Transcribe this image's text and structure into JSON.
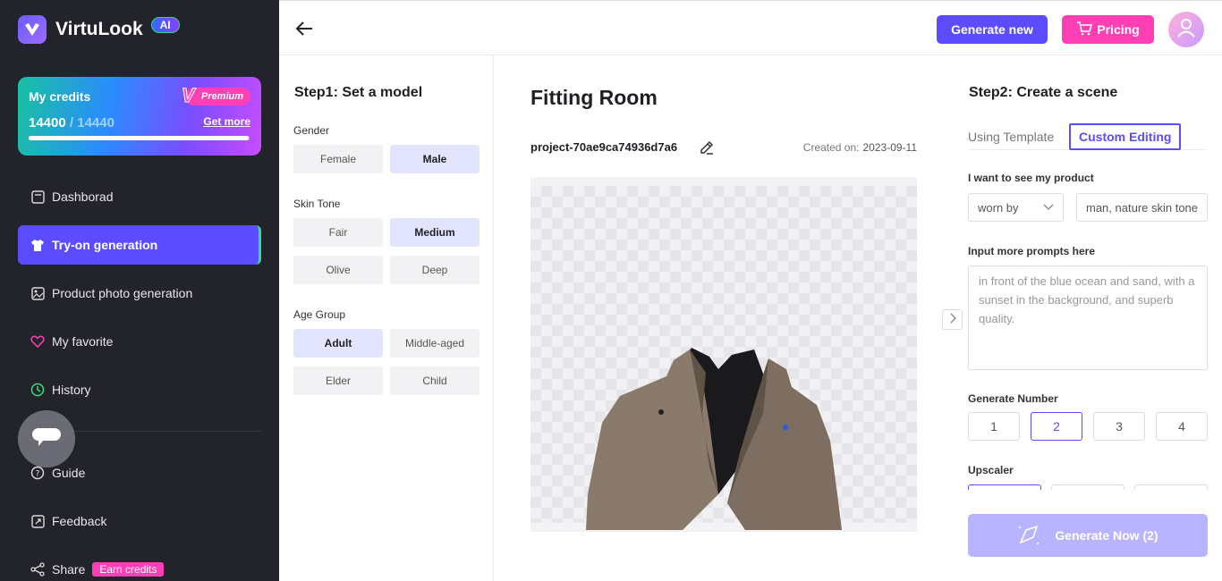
{
  "app": {
    "name": "VirtuLook",
    "ai_badge": "AI"
  },
  "credits": {
    "title": "My credits",
    "premium_label": "Premium",
    "premium_mark": "V",
    "current": "14400",
    "separator": " / ",
    "max": "14440",
    "get_more": "Get more",
    "progress": 0.997
  },
  "sidebar": {
    "items": [
      {
        "label": "Dashborad",
        "icon": "dashboard-icon"
      },
      {
        "label": "Try-on generation",
        "icon": "shirt-icon",
        "active": true
      },
      {
        "label": "Product photo generation",
        "icon": "image-icon"
      },
      {
        "label": "My favorite",
        "icon": "heart-icon"
      },
      {
        "label": "History",
        "icon": "history-icon"
      }
    ],
    "bottom": [
      {
        "label": "Guide",
        "icon": "question-icon"
      },
      {
        "label": "Feedback",
        "icon": "feedback-icon"
      },
      {
        "label": "Share",
        "icon": "share-icon",
        "badge": "Earn credits"
      }
    ]
  },
  "topbar": {
    "generate_new": "Generate new",
    "pricing": "Pricing"
  },
  "step1": {
    "title": "Step1: Set a model",
    "gender": {
      "label": "Gender",
      "options": [
        "Female",
        "Male"
      ],
      "selected": "Male"
    },
    "skin": {
      "label": "Skin Tone",
      "options": [
        "Fair",
        "Medium",
        "Olive",
        "Deep"
      ],
      "selected": "Medium"
    },
    "age": {
      "label": "Age Group",
      "options": [
        "Adult",
        "Middle-aged",
        "Elder",
        "Child"
      ],
      "selected": "Adult"
    }
  },
  "fitting": {
    "title": "Fitting Room",
    "project": "project-70ae9ca74936d7a6",
    "created_label": "Created on:",
    "created_date": "2023-09-11"
  },
  "step2": {
    "title": "Step2: Create a scene",
    "tabs": [
      "Using Template",
      "Custom Editing"
    ],
    "active_tab": "Custom Editing",
    "product_label": "I want to see my product",
    "worn_by": "worn by",
    "worn_by_value": "man, nature skin tone",
    "prompts_label": "Input more prompts here",
    "prompts_placeholder": "in front of the blue ocean and sand, with a sunset in the background, and superb quality.",
    "number_label": "Generate Number",
    "numbers": [
      "1",
      "2",
      "3",
      "4"
    ],
    "selected_number": "2",
    "upscaler_label": "Upscaler",
    "generate_now": "Generate Now (2)"
  },
  "colors": {
    "primary": "#5b4dff",
    "pink": "#ff3fb4",
    "sidebar": "#23232b",
    "disabled": "#b9b4ff"
  }
}
